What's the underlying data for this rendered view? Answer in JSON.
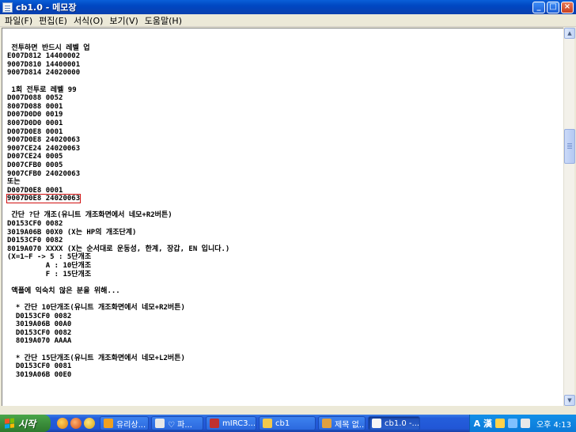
{
  "window": {
    "title": "cb1.0 - 메모장",
    "minimize": "_",
    "maximize": "□",
    "close": "×"
  },
  "menu": {
    "items": [
      "파일(F)",
      "편집(E)",
      "서식(O)",
      "보기(V)",
      "도움말(H)"
    ]
  },
  "document": {
    "lines": [
      "",
      " 전투하면 반드시 레벨 업",
      "E007D812 14400002",
      "9007D810 14400001",
      "9007D814 24020000",
      "",
      " 1회 전투로 레벨 99",
      "D007D088 0052",
      "8007D088 0001",
      "D007D0D0 0019",
      "8007D0D0 0001",
      "D007D0E8 0001",
      "9007D0E8 24020063",
      "9007CE24 24020063",
      "D007CE24 0005",
      "D007CFB0 0005",
      "9007CFB0 24020063",
      "또는",
      "D007D0E8 0001",
      "9007D0E8 24020063",
      "",
      " 간단 ?단 개조(유니트 개조화면에서 네모+R2버튼)",
      "D0153CF0 0082",
      "3019A06B 00X0 (X는 HP의 개조단계)",
      "D0153CF0 0082",
      "8019A070 XXXX (X는 순서대로 운동성, 한계, 장갑, EN 입니다.)",
      "(X=1~F -> 5 : 5단개조",
      "         A : 10단개조",
      "         F : 15단개조",
      "",
      " 액플에 익숙치 않은 분을 위해...",
      "",
      "  * 간단 10단개조(유니트 개조화면에서 네모+R2버튼)",
      "  D0153CF0 0082",
      "  3019A06B 00A0",
      "  D0153CF0 0082",
      "  8019A070 AAAA",
      "",
      "  * 간단 15단개조(유니트 개조화면에서 네모+L2버튼)",
      "  D0153CF0 0081",
      "  3019A06B 00E0"
    ],
    "highlighted_line_index": 19
  },
  "taskbar": {
    "start_label": "시작",
    "tasks": [
      {
        "label": "유리상...",
        "color": "#f0a020"
      },
      {
        "label": "♡ 파...",
        "color": "#e8e8e8"
      },
      {
        "label": "mIRC3...",
        "color": "#c03030"
      },
      {
        "label": "cb1",
        "color": "#f2c84b"
      },
      {
        "label": "제목 없...",
        "color": "#e0a040"
      },
      {
        "label": "cb1.0 -...",
        "color": "#f6f6f6"
      }
    ],
    "active_task_index": 5,
    "ime": "A 漢",
    "clock": "오후 4:13"
  },
  "colors": {
    "title_blue": "#0047c2",
    "highlight_box": "#d01010",
    "start_green": "#3b8e3b"
  }
}
